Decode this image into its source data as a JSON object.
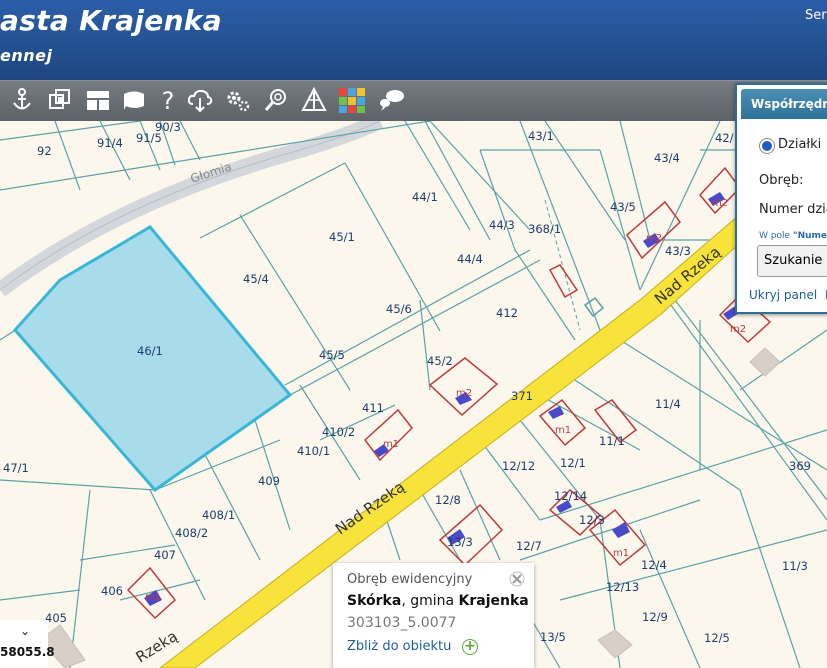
{
  "header": {
    "title": "asta Krajenka",
    "subtitle": "ennej",
    "right_text": "Ser"
  },
  "toolbar": {
    "icons": [
      "anchor-icon",
      "layers-icon",
      "layout-icon",
      "speech-icon",
      "help-icon",
      "cloud-download-icon",
      "settings-icon",
      "zoom-icon",
      "measure-icon",
      "color-grid-icon",
      "comment-icon"
    ]
  },
  "map": {
    "road_name": "Nad Rzeką",
    "road_name_partial": "Rzeką",
    "river_name": "Głomia",
    "highlighted_parcel": "46/1",
    "parcel_labels": [
      "92",
      "91/4",
      "90/3",
      "91/5",
      "43/1",
      "42/",
      "43/4",
      "44/1",
      "43/5",
      "45/1",
      "44/3",
      "368/1",
      "43/3",
      "45/4",
      "44/4",
      "46/1",
      "45/6",
      "412",
      "45/5",
      "45/2",
      "371",
      "411",
      "11/4",
      "410/2",
      "11/1",
      "410/1",
      "12/12",
      "12/1",
      "369",
      "47/1",
      "409",
      "12/8",
      "12/14",
      "408/1",
      "12/3",
      "408/2",
      "13/3",
      "12/7",
      "407",
      "12/4",
      "11/3",
      "406",
      "12/13",
      "405",
      "12/9",
      "13/5",
      "12/5"
    ],
    "building_labels": [
      "m2",
      "m1",
      "m1",
      "m2",
      "m2",
      "m2",
      "m1",
      "m1"
    ]
  },
  "panel": {
    "tab_label": "Współrzędne",
    "radio_label": "Działki",
    "obreb_label": "Obręb:",
    "numer_label": "Numer dzia",
    "note_prefix": "W pole ",
    "note_bold": "\"Nume",
    "select_value": "Szukanie",
    "hide_link": "Ukryj panel",
    "extra_link": "I"
  },
  "popup": {
    "heading": "Obręb ewidencyjny",
    "obreb_name": "Skórka",
    "gmina_prefix": ", gmina ",
    "gmina_name": "Krajenka",
    "code": "303103_5.0077",
    "zoom_link": "Zbliż do obiektu"
  },
  "coords": {
    "value": "58055.8"
  },
  "colors": {
    "header_bg": "#2656a0",
    "toolbar_bg": "#676c73",
    "map_bg": "#fbf7ec",
    "parcel_line": "#5aa2a8",
    "highlight_fill": "#a9dcea",
    "highlight_stroke": "#38b6d8",
    "road": "#f7e339",
    "building_stroke": "#c0393c"
  }
}
